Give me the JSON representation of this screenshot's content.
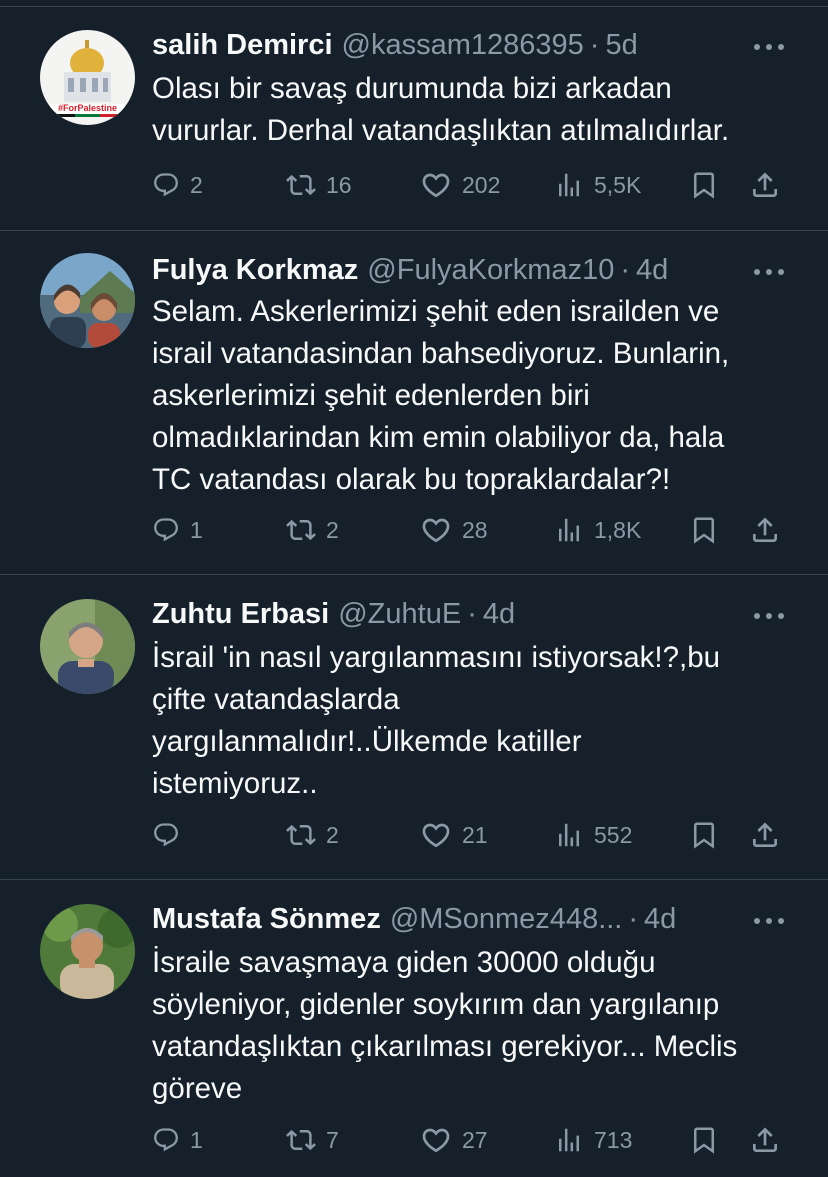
{
  "colors": {
    "background": "#15202b",
    "text": "#f7f9f9",
    "muted": "#8b98a5",
    "divider": "#38444d"
  },
  "tweets": [
    {
      "name": "salih Demirci",
      "handle": "@kassam1286395",
      "separator": "·",
      "time": "5d",
      "text": "Olası bir savaş durumunda bizi arkadan\nvururlar. Derhal vatandaşlıktan atılmalıdırlar.",
      "avatar_badge": "#ForPalestine",
      "replies": "2",
      "retweets": "16",
      "likes": "202",
      "views": "5,5K"
    },
    {
      "name": "Fulya Korkmaz",
      "handle": "@FulyaKorkmaz10",
      "separator": "·",
      "time": "4d",
      "text": "Selam. Askerlerimizi şehit eden israilden ve\nisrail vatandasindan bahsediyoruz. Bunlarin,\naskerlerimizi şehit edenlerden biri\nolmadıklarindan kim emin olabiliyor da, hala\nTC vatandası olarak bu topraklardalar?!",
      "replies": "1",
      "retweets": "2",
      "likes": "28",
      "views": "1,8K"
    },
    {
      "name": "Zuhtu Erbasi",
      "handle": "@ZuhtuE",
      "separator": "·",
      "time": "4d",
      "text": "İsrail 'in nasıl yargılanmasını istiyorsak!?,bu\nçifte vatandaşlarda\nyargılanmalıdır!..Ülkemde katiller\nistemiyoruz..",
      "replies": "",
      "retweets": "2",
      "likes": "21",
      "views": "552"
    },
    {
      "name": "Mustafa Sönmez",
      "handle": "@MSonmez448...",
      "separator": "·",
      "time": "4d",
      "text": "İsraile savaşmaya giden 30000 olduğu\nsöyleniyor, gidenler soykırım dan yargılanıp\nvatandaşlıktan çıkarılması gerekiyor... Meclis\ngöreve",
      "replies": "1",
      "retweets": "7",
      "likes": "27",
      "views": "713"
    }
  ]
}
